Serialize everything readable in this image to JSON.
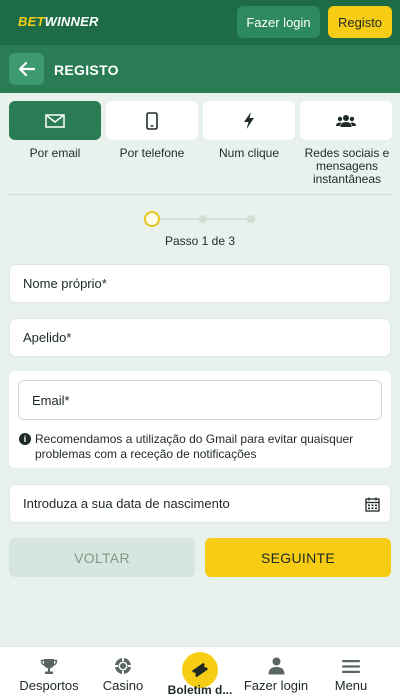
{
  "header": {
    "logo_bet": "BET",
    "logo_winner": "WINNER",
    "login_label": "Fazer login",
    "register_label": "Registo"
  },
  "titlebar": {
    "title": "REGISTO"
  },
  "tabs": [
    {
      "label": "Por email",
      "icon": "envelope-icon",
      "active": true
    },
    {
      "label": "Por telefone",
      "icon": "phone-icon",
      "active": false
    },
    {
      "label": "Num clique",
      "icon": "lightning-icon",
      "active": false
    },
    {
      "label": "Redes sociais e mensagens instantâneas",
      "icon": "users-icon",
      "active": false
    }
  ],
  "stepper": {
    "text": "Passo 1 de 3",
    "current": 1,
    "total": 3
  },
  "form": {
    "first_name_placeholder": "Nome próprio*",
    "last_name_placeholder": "Apelido*",
    "email_placeholder": "Email*",
    "email_hint": "Recomendamos a utilização do Gmail para evitar quaisquer problemas com a receção de notificações",
    "dob_placeholder": "Introduza a sua data de nascimento"
  },
  "actions": {
    "back_label": "VOLTAR",
    "next_label": "SEGUINTE"
  },
  "bottom_nav": [
    {
      "label": "Desportos",
      "icon": "trophy-icon"
    },
    {
      "label": "Casino",
      "icon": "casino-chip-icon"
    },
    {
      "label": "Boletim d...",
      "icon": "ticket-icon"
    },
    {
      "label": "Fazer login",
      "icon": "user-icon"
    },
    {
      "label": "Menu",
      "icon": "hamburger-icon"
    }
  ],
  "colors": {
    "primary_green": "#2a7c55",
    "dark_green": "#1e6b47",
    "accent_yellow": "#f6cc15",
    "background": "#e8f1ec"
  }
}
